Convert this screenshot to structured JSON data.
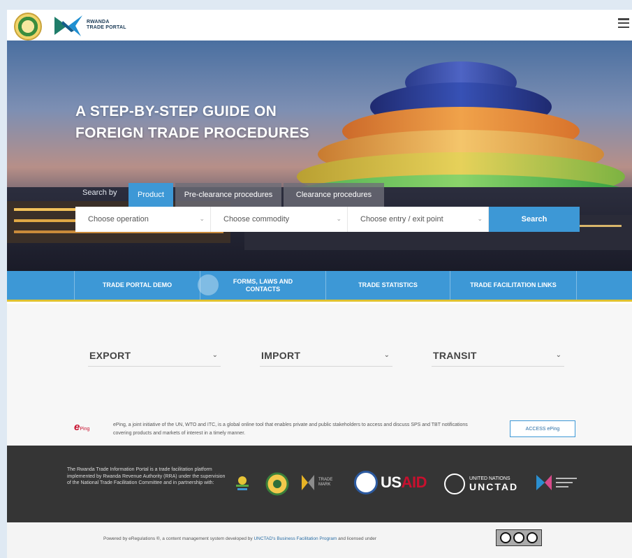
{
  "header": {
    "logo_line1": "RWANDA",
    "logo_line2": "TRADE PORTAL"
  },
  "hero": {
    "title_line1": "A STEP-BY-STEP GUIDE ON",
    "title_line2": "FOREIGN TRADE PROCEDURES",
    "search_by": "Search by",
    "tabs": [
      "Product",
      "Pre-clearance procedures",
      "Clearance procedures"
    ],
    "selects": [
      "Choose operation",
      "Choose commodity",
      "Choose entry / exit point"
    ],
    "search_label": "Search"
  },
  "quick_links": [
    "TRADE PORTAL DEMO",
    "FORMS, LAWS AND CONTACTS",
    "TRADE STATISTICS",
    "TRADE FACILITATION LINKS"
  ],
  "flows": [
    "EXPORT",
    "IMPORT",
    "TRANSIT"
  ],
  "eping": {
    "logo_text": "Ping",
    "description": "ePing, a joint initiative of the UN, WTO and ITC, is a global online tool that enables private and public stakeholders to access and discuss SPS and TBT notifications covering products and markets of interest in a timely manner.",
    "button": "ACCESS ePing"
  },
  "footer": {
    "about": "The Rwanda Trade Information Portal is a trade facilitation platform implemented by Rwanda Revenue Authority (RRA) under the supervision of the National Trade Facilitation Committee and in partnership with:",
    "partners": {
      "trademark": "TRADE MARK",
      "usaid_us": "US",
      "usaid_aid": "AID",
      "un_line1": "UNITED NATIONS",
      "un_line2": "UNCTAD"
    },
    "powered_prefix": "Powered by eRegulations ®, a content management system developed by",
    "powered_link": "UNCTAD's Business Facilitation Program",
    "powered_suffix": "and licensed under"
  },
  "colors": {
    "accent": "#3d98d6",
    "yellow_rule": "#e0c230",
    "footer_bg": "#353535"
  }
}
